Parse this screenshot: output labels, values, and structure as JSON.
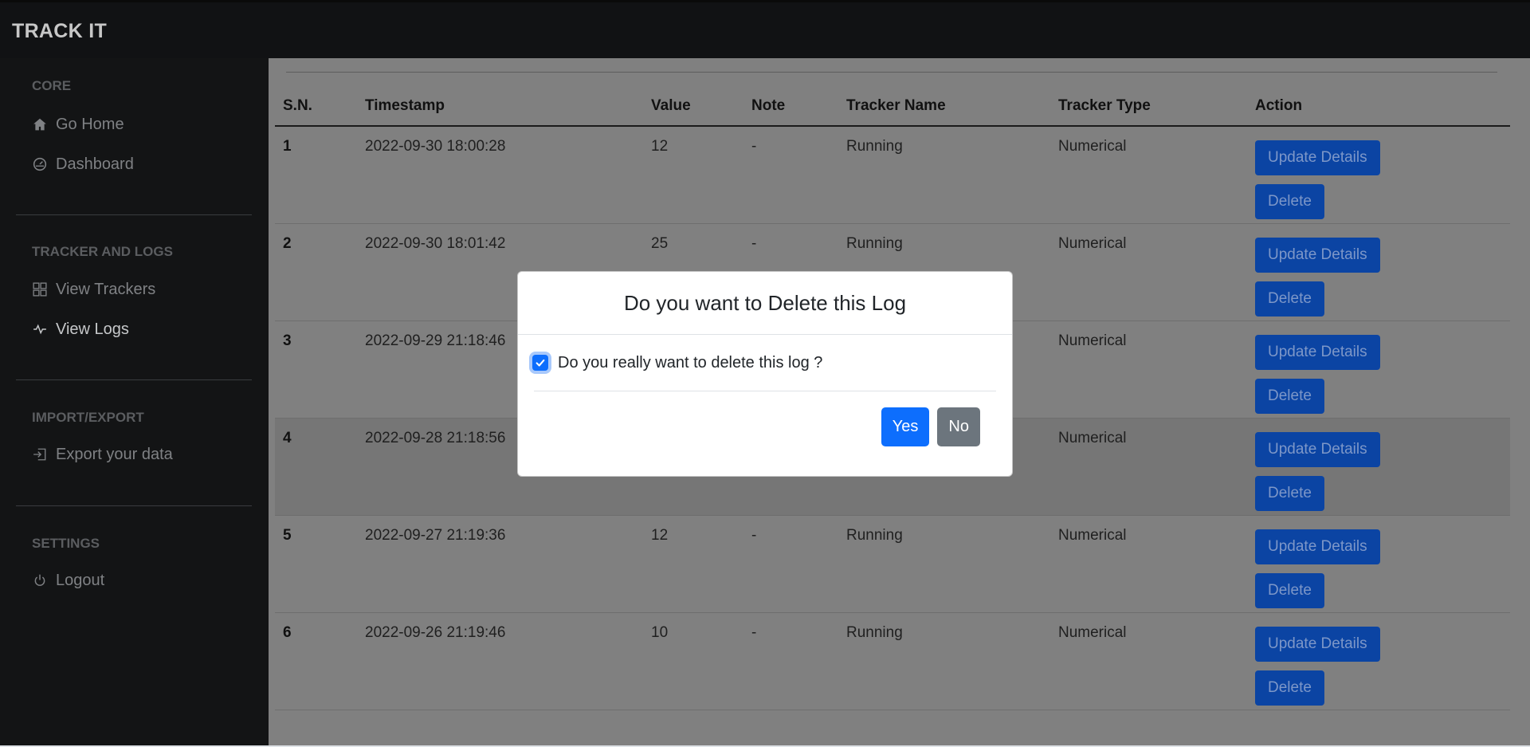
{
  "app": {
    "brand": "TRACK IT"
  },
  "sidebar": {
    "sections": [
      {
        "heading": "CORE",
        "items": [
          {
            "label": "Go Home",
            "icon": "home-icon"
          },
          {
            "label": "Dashboard",
            "icon": "gauge-icon"
          }
        ]
      },
      {
        "heading": "TRACKER AND LOGS",
        "items": [
          {
            "label": "View Trackers",
            "icon": "grid-icon"
          },
          {
            "label": "View Logs",
            "icon": "activity-icon",
            "active": true
          }
        ]
      },
      {
        "heading": "IMPORT/EXPORT",
        "items": [
          {
            "label": "Export your data",
            "icon": "export-icon"
          }
        ]
      },
      {
        "heading": "SETTINGS",
        "items": [
          {
            "label": "Logout",
            "icon": "power-icon"
          }
        ]
      }
    ]
  },
  "main": {
    "table": {
      "headers": [
        "S.N.",
        "Timestamp",
        "Value",
        "Note",
        "Tracker Name",
        "Tracker Type",
        "Action"
      ],
      "update_label": "Update Details",
      "delete_label": "Delete",
      "rows": [
        {
          "sn": "1",
          "timestamp": "2022-09-30 18:00:28",
          "value": "12",
          "note": "-",
          "tracker_name": "Running",
          "tracker_type": "Numerical"
        },
        {
          "sn": "2",
          "timestamp": "2022-09-30 18:01:42",
          "value": "25",
          "note": "-",
          "tracker_name": "Running",
          "tracker_type": "Numerical"
        },
        {
          "sn": "3",
          "timestamp": "2022-09-29 21:18:46",
          "value": "",
          "note": "",
          "tracker_name": "",
          "tracker_type": "Numerical"
        },
        {
          "sn": "4",
          "timestamp": "2022-09-28 21:18:56",
          "value": "",
          "note": "",
          "tracker_name": "",
          "tracker_type": "Numerical"
        },
        {
          "sn": "5",
          "timestamp": "2022-09-27 21:19:36",
          "value": "12",
          "note": "-",
          "tracker_name": "Running",
          "tracker_type": "Numerical"
        },
        {
          "sn": "6",
          "timestamp": "2022-09-26 21:19:46",
          "value": "10",
          "note": "-",
          "tracker_name": "Running",
          "tracker_type": "Numerical"
        }
      ]
    }
  },
  "modal": {
    "title": "Do you want to Delete this Log",
    "checkbox_label": "Do you really want to delete this log ?",
    "checkbox_checked": true,
    "yes_label": "Yes",
    "no_label": "No"
  },
  "colors": {
    "primary": "#0d6efd",
    "secondary": "#6c757d",
    "sidebar_bg": "#131415",
    "navbar_bg": "#111214"
  }
}
